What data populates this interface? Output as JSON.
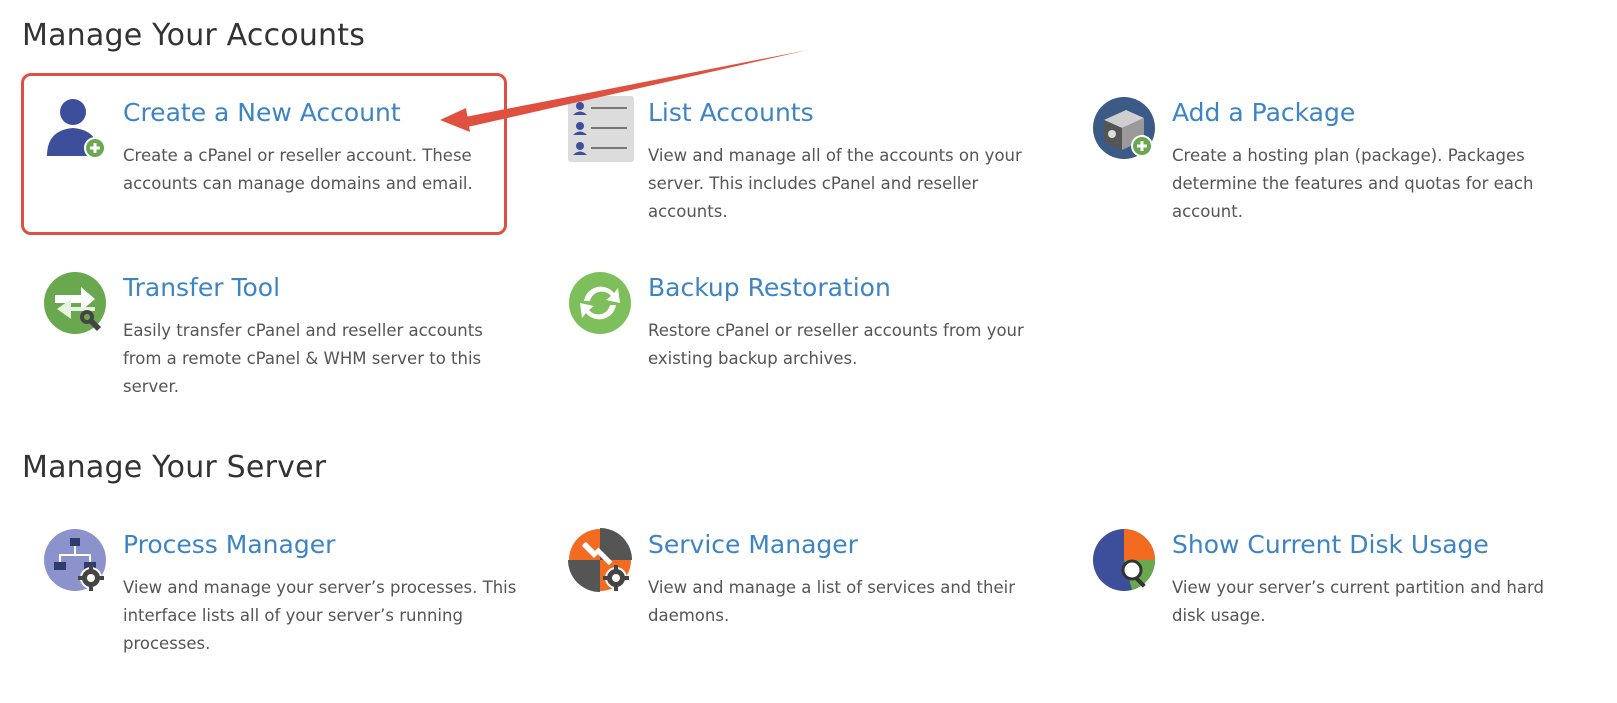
{
  "sections": {
    "accounts_title": "Manage Your Accounts",
    "server_title": "Manage Your Server"
  },
  "accounts": [
    {
      "title": "Create a New Account",
      "desc": "Create a cPanel or reseller account. These accounts can manage domains and email.",
      "icon": "user-add-icon"
    },
    {
      "title": "List Accounts",
      "desc": "View and manage all of the accounts on your server. This includes cPanel and reseller accounts.",
      "icon": "user-list-icon"
    },
    {
      "title": "Add a Package",
      "desc": "Create a hosting plan (package). Packages determine the features and quotas for each account.",
      "icon": "package-add-icon"
    },
    {
      "title": "Transfer Tool",
      "desc": "Easily transfer cPanel and reseller accounts from a remote cPanel & WHM server to this server.",
      "icon": "transfer-tool-icon"
    },
    {
      "title": "Backup Restoration",
      "desc": "Restore cPanel or reseller accounts from your existing backup archives.",
      "icon": "backup-restore-icon"
    }
  ],
  "server": [
    {
      "title": "Process Manager",
      "desc": "View and manage your server’s processes. This interface lists all of your server’s running processes.",
      "icon": "process-manager-icon"
    },
    {
      "title": "Service Manager",
      "desc": "View and manage a list of services and their daemons.",
      "icon": "service-manager-icon"
    },
    {
      "title": "Show Current Disk Usage",
      "desc": "View your server’s current partition and hard disk usage.",
      "icon": "disk-usage-icon"
    }
  ],
  "colors": {
    "link": "#3d84c6",
    "annotation": "#e05040",
    "icon_blue": "#3d4f9a",
    "icon_green": "#6aa84f",
    "icon_orange": "#f26b21"
  }
}
